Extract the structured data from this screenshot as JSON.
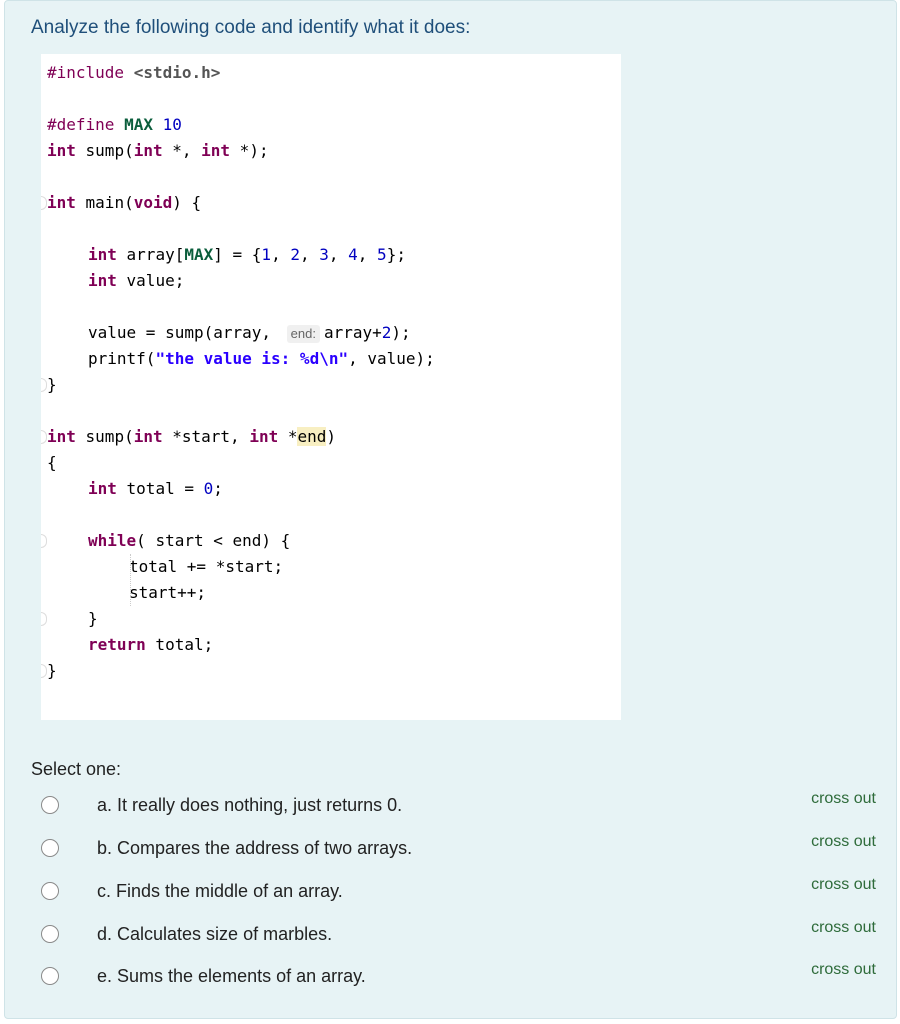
{
  "question": {
    "text": "Analyze the following code and identify what it does:"
  },
  "code": {
    "include_directive": "#include",
    "include_file": "<stdio.h>",
    "define_directive": "#define",
    "define_name": "MAX",
    "define_value": "10",
    "kw_int": "int",
    "kw_void": "void",
    "kw_while": "while",
    "kw_return": "return",
    "proto_rest": " sump(",
    "proto_ptr": " *, ",
    "proto_end": " *);",
    "main_name": " main(",
    "main_end": ") {",
    "array_decl_a": " array[",
    "array_decl_b": "] = {",
    "n1": "1",
    "n2": "2",
    "n3": "3",
    "n4": "4",
    "n5": "5",
    "comma": ", ",
    "array_end": "};",
    "value_decl": " value;",
    "call_a": "value = sump(array, ",
    "param_hint": "end:",
    "call_b": "array+",
    "call_c": ");",
    "printf_a": "printf(",
    "printf_str": "\"the value is: %d\\n\"",
    "printf_b": ", value);",
    "close_brace": "}",
    "open_brace": "{",
    "sump_def_a": " sump(",
    "sump_def_b": " *start, ",
    "sump_def_c": " *",
    "sump_end_param": "end",
    "sump_def_d": ")",
    "total_decl": " total = ",
    "zero": "0",
    "semicolon": ";",
    "while_cond": "( start < end) {",
    "total_add": "total += *start;",
    "start_inc": "start++;",
    "return_rest": " total;"
  },
  "prompt": {
    "select_one": "Select one:"
  },
  "options": [
    {
      "label": "a. It really does nothing, just returns 0.",
      "cross_out": "cross out"
    },
    {
      "label": "b. Compares the address of two arrays.",
      "cross_out": "cross out"
    },
    {
      "label": "c. Finds the middle of an array.",
      "cross_out": "cross out"
    },
    {
      "label": "d. Calculates size of marbles.",
      "cross_out": "cross out"
    },
    {
      "label": "e. Sums the elements of an array.",
      "cross_out": "cross out"
    }
  ]
}
